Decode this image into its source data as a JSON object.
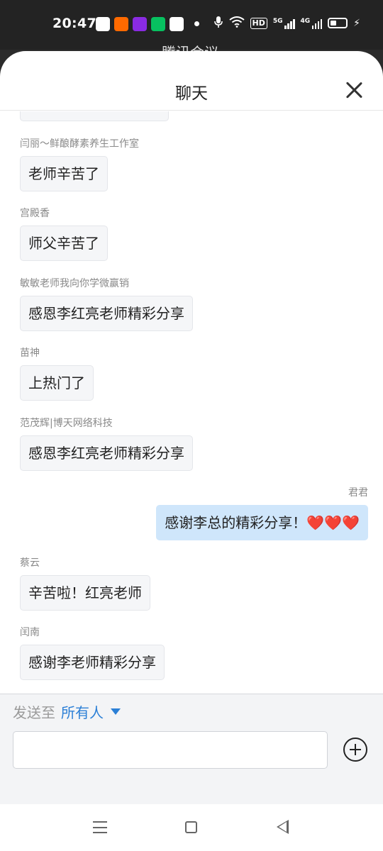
{
  "status_bar": {
    "time": "20:47",
    "network_5g": "5G",
    "network_4g": "4G",
    "hd_label": "HD",
    "notification_icons": [
      "video-app-icon",
      "kuaishou-icon",
      "music-player-icon",
      "wechat-pay-icon",
      "maps-icon"
    ]
  },
  "background_app": {
    "title": "腾讯会议"
  },
  "header": {
    "title": "聊天"
  },
  "messages": [
    {
      "sender": "闫丽～鲜酿酵素养生工作室",
      "text": "老师辛苦了",
      "self": false
    },
    {
      "sender": "宫殿香",
      "text": "师父辛苦了",
      "self": false
    },
    {
      "sender": "敏敏老师我向你学微赢销",
      "text": "感恩李红亮老师精彩分享",
      "self": false
    },
    {
      "sender": "苗神",
      "text": "上热门了",
      "self": false
    },
    {
      "sender": "范茂辉|博天网络科技",
      "text": "感恩李红亮老师精彩分享",
      "self": false
    },
    {
      "sender": "君君",
      "text": "感谢李总的精彩分享！❤️❤️❤️",
      "self": true
    },
    {
      "sender": "蔡云",
      "text": "辛苦啦！红亮老师",
      "self": false
    },
    {
      "sender": "闰南",
      "text": "感谢李老师精彩分享",
      "self": false
    }
  ],
  "compose": {
    "send_to_label": "发送至",
    "recipient": "所有人",
    "input_value": "",
    "input_placeholder": ""
  },
  "colors": {
    "accent": "#2b7fd6",
    "self_bubble": "#cfe6fb",
    "other_bubble": "#f5f6f8"
  }
}
